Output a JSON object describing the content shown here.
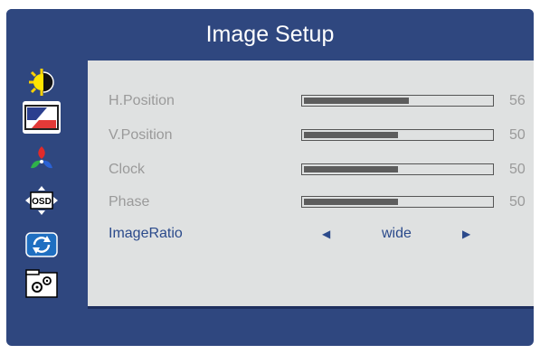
{
  "title": "Image Setup",
  "sidebar": {
    "items": [
      {
        "name": "brightness-contrast-icon"
      },
      {
        "name": "image-setup-icon"
      },
      {
        "name": "color-setup-icon"
      },
      {
        "name": "osd-setup-icon"
      },
      {
        "name": "reset-icon"
      },
      {
        "name": "extra-settings-icon"
      }
    ]
  },
  "settings": [
    {
      "label": "H.Position",
      "value": "56",
      "level": 56
    },
    {
      "label": "V.Position",
      "value": "50",
      "level": 50
    },
    {
      "label": "Clock",
      "value": "50",
      "level": 50
    },
    {
      "label": "Phase",
      "value": "50",
      "level": 50
    }
  ],
  "image_ratio": {
    "label": "ImageRatio",
    "value": "wide",
    "left_arrow": "◀",
    "right_arrow": "▶"
  },
  "colors": {
    "frame": "#2f477f",
    "panel": "#dfe1e1",
    "selected_text": "#2b4a8b",
    "inactive_text": "#9a9a9a",
    "slider_fill": "#5d5d5d"
  }
}
